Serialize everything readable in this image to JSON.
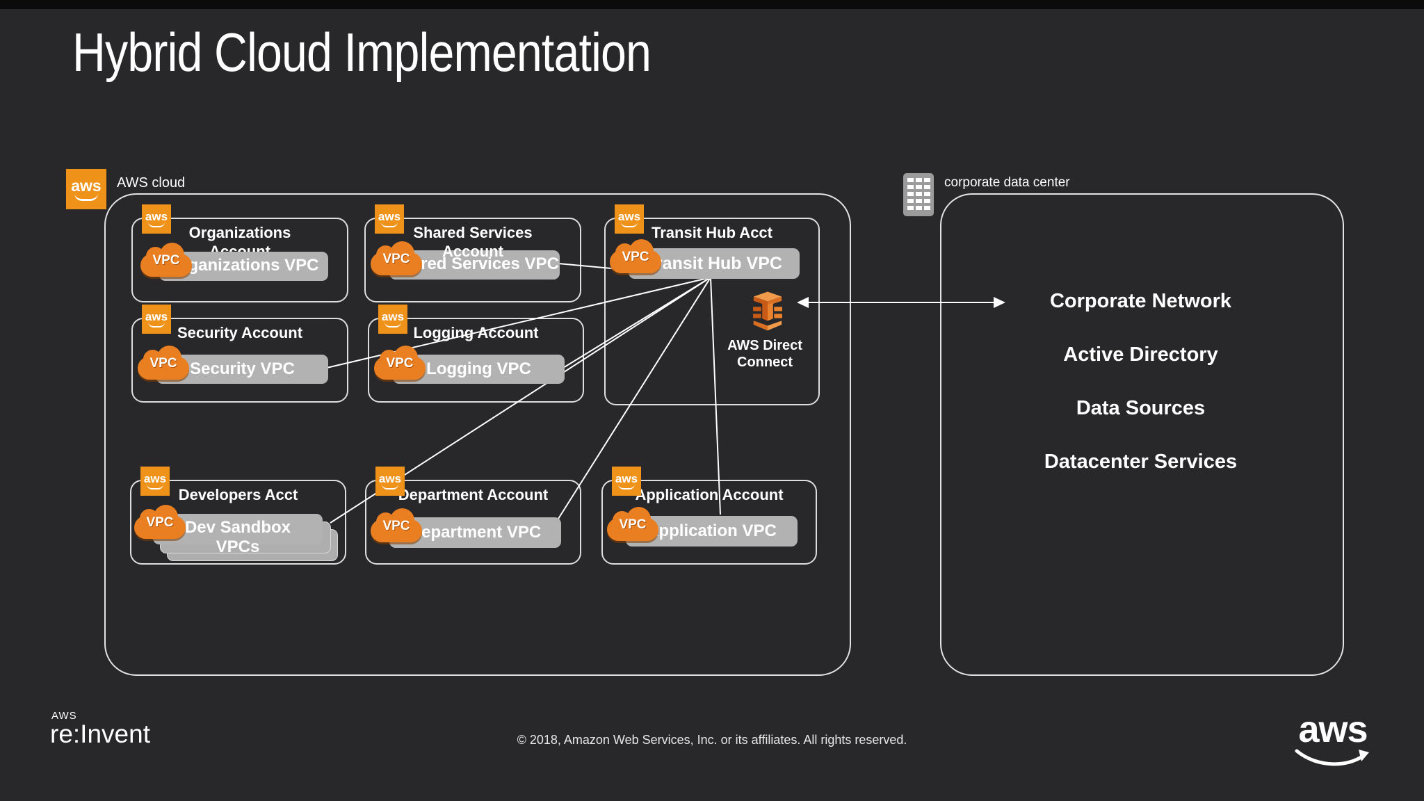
{
  "slide": {
    "title": "Hybrid Cloud Implementation",
    "copyright": "© 2018, Amazon Web Services, Inc. or its affiliates. All rights reserved.",
    "reinvent_logo_top": "AWS",
    "reinvent_logo_text": "re:Invent",
    "aws_logo_text": "aws"
  },
  "aws_cloud": {
    "label": "AWS cloud",
    "aws_badge_label": "aws",
    "vpc_icon_label": "VPC",
    "direct_connect_label": "AWS Direct Connect",
    "accounts": [
      {
        "title": "Organizations Account",
        "vpc": "Organizations VPC"
      },
      {
        "title": "Shared Services Account",
        "vpc": "Shared Services VPC"
      },
      {
        "title": "Transit Hub Acct",
        "vpc": "Transit Hub VPC"
      },
      {
        "title": "Security Account",
        "vpc": "Security VPC"
      },
      {
        "title": "Logging Account",
        "vpc": "Logging VPC"
      },
      {
        "title": "Developers Acct",
        "vpc": "Dev Sandbox VPCs"
      },
      {
        "title": "Department Account",
        "vpc": "Department VPC"
      },
      {
        "title": "Application Account",
        "vpc": "Application VPC"
      }
    ]
  },
  "corporate_data_center": {
    "label": "corporate data center",
    "items": [
      "Corporate Network",
      "Active Directory",
      "Data Sources",
      "Datacenter Services"
    ]
  },
  "colors": {
    "background": "#28282A",
    "aws_orange": "#EF9219",
    "vpc_cloud_orange": "#EA7F21",
    "direct_connect_orange_dark": "#C75B16",
    "direct_connect_orange_light": "#F09A4C",
    "bar_gray": "#B2B2B2",
    "line_white": "#FFFFFF"
  }
}
